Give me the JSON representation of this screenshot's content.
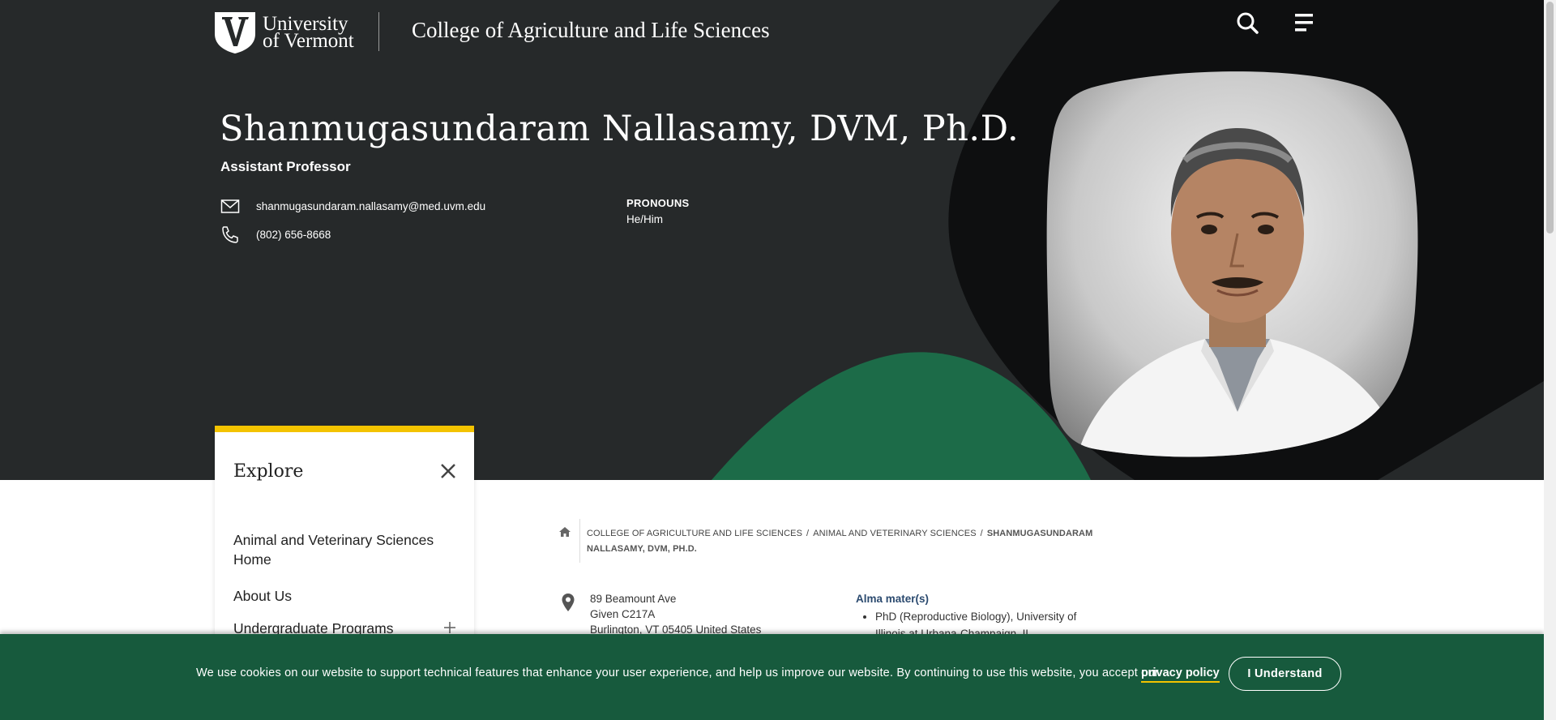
{
  "header": {
    "logo_line1": "University",
    "logo_line2": "of Vermont",
    "college_name": "College of Agriculture and Life Sciences",
    "search_icon": "search-icon",
    "menu_icon": "menu-icon"
  },
  "profile": {
    "name": "Shanmugasundaram Nallasamy, DVM, Ph.D.",
    "title": "Assistant Professor",
    "email": "shanmugasundaram.nallasamy@med.uvm.edu",
    "phone": "(802) 656-8668",
    "pronouns_label": "PRONOUNS",
    "pronouns_value": "He/Him"
  },
  "explore": {
    "title": "Explore",
    "items": [
      {
        "label": "Animal and Veterinary Sciences Home"
      },
      {
        "label": "About Us"
      },
      {
        "label": "Undergraduate Programs"
      }
    ]
  },
  "breadcrumb": {
    "items": [
      {
        "label": "College of Agriculture and Life Sciences"
      },
      {
        "label": "Animal and Veterinary Sciences"
      }
    ],
    "separator": "/",
    "current": "Shanmugasundaram Nallasamy, DVM, Ph.D."
  },
  "address": {
    "line1": "89 Beamount Ave",
    "line2": "Given C217A",
    "line3": "Burlington, VT 05405 United States"
  },
  "alma_mater": {
    "label": "Alma mater(s)",
    "items": [
      "PhD (Reproductive Biology), University of Illinois at Urbana-Champaign, IL"
    ]
  },
  "cookie": {
    "text": "We use cookies on our website to support technical features that enhance your user experience, and help us improve our website. By continuing to use this website, you accept our",
    "link": "privacy policy",
    "button": "I Understand"
  },
  "colors": {
    "hero_bg": "#26292a",
    "accent_green": "#175a3d",
    "accent_yellow": "#f3c300"
  }
}
